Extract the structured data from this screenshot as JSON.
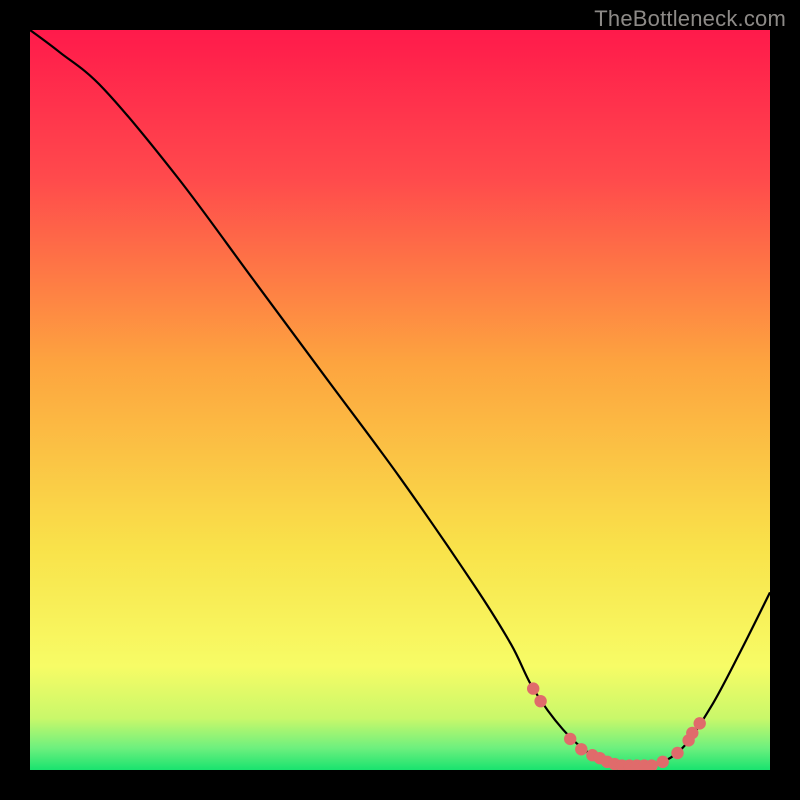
{
  "attribution": "TheBottleneck.com",
  "chart_data": {
    "type": "line",
    "title": "",
    "xlabel": "",
    "ylabel": "",
    "xlim": [
      0,
      100
    ],
    "ylim": [
      0,
      100
    ],
    "gradient_stops": [
      {
        "offset": 0.0,
        "color": "#ff1a4b"
      },
      {
        "offset": 0.2,
        "color": "#ff4a4c"
      },
      {
        "offset": 0.45,
        "color": "#fda43f"
      },
      {
        "offset": 0.7,
        "color": "#f9e24a"
      },
      {
        "offset": 0.86,
        "color": "#f7fc66"
      },
      {
        "offset": 0.93,
        "color": "#c9f86a"
      },
      {
        "offset": 0.97,
        "color": "#6ef07e"
      },
      {
        "offset": 1.0,
        "color": "#19e36f"
      }
    ],
    "series": [
      {
        "name": "bottleneck-curve",
        "x": [
          0,
          4,
          10,
          20,
          30,
          40,
          50,
          60,
          65,
          68,
          72,
          76,
          80,
          84,
          88,
          92,
          96,
          100
        ],
        "y": [
          100,
          97,
          92,
          80,
          66.5,
          53,
          39.5,
          25,
          17,
          11,
          5.5,
          2,
          0.6,
          0.6,
          2.8,
          8.5,
          16,
          24
        ]
      }
    ],
    "markers": {
      "name": "optimal-range",
      "color": "#e06b6b",
      "points": [
        {
          "x": 68,
          "y": 11.0
        },
        {
          "x": 69,
          "y": 9.3
        },
        {
          "x": 73,
          "y": 4.2
        },
        {
          "x": 74.5,
          "y": 2.8
        },
        {
          "x": 76,
          "y": 2.0
        },
        {
          "x": 77,
          "y": 1.6
        },
        {
          "x": 78,
          "y": 1.1
        },
        {
          "x": 79,
          "y": 0.8
        },
        {
          "x": 80,
          "y": 0.6
        },
        {
          "x": 81,
          "y": 0.6
        },
        {
          "x": 82,
          "y": 0.6
        },
        {
          "x": 83,
          "y": 0.6
        },
        {
          "x": 84,
          "y": 0.6
        },
        {
          "x": 85.5,
          "y": 1.1
        },
        {
          "x": 87.5,
          "y": 2.3
        },
        {
          "x": 89,
          "y": 4.0
        },
        {
          "x": 89.5,
          "y": 5.0
        },
        {
          "x": 90.5,
          "y": 6.3
        }
      ]
    }
  }
}
